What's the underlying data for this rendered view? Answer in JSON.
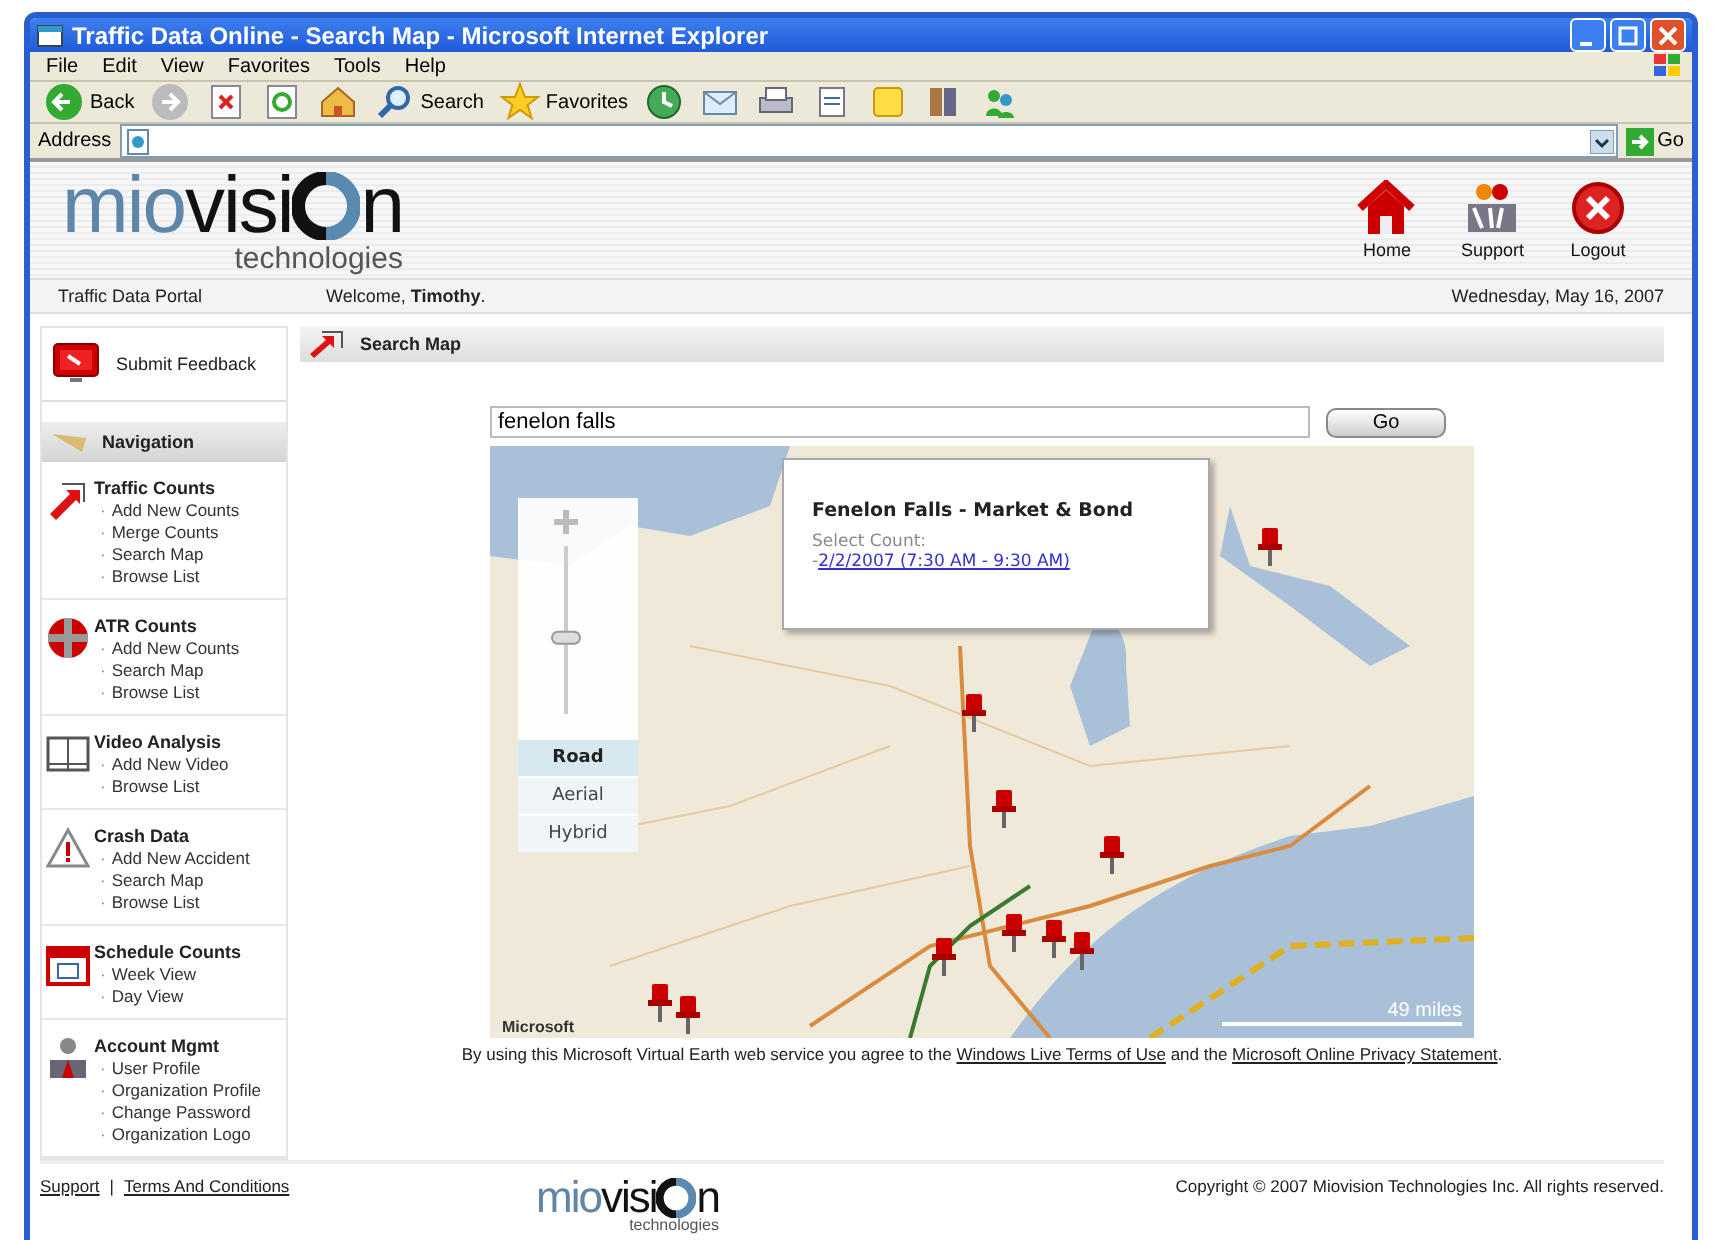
{
  "window": {
    "title": "Traffic Data Online - Search Map - Microsoft Internet Explorer"
  },
  "menu": [
    "File",
    "Edit",
    "View",
    "Favorites",
    "Tools",
    "Help"
  ],
  "toolbar": [
    {
      "kind": "back",
      "label": "Back"
    },
    {
      "kind": "forward"
    },
    {
      "kind": "stop"
    },
    {
      "kind": "refresh"
    },
    {
      "kind": "home"
    },
    {
      "kind": "search",
      "label": "Search"
    },
    {
      "kind": "favorites",
      "label": "Favorites"
    },
    {
      "kind": "history"
    },
    {
      "kind": "mail"
    },
    {
      "kind": "print"
    },
    {
      "kind": "edit"
    },
    {
      "kind": "note"
    },
    {
      "kind": "research"
    },
    {
      "kind": "messenger"
    }
  ],
  "address": {
    "label": "Address",
    "go": "Go"
  },
  "logo": {
    "left": "mio",
    "middle": "visi",
    "right": "n",
    "tagline": "technologies"
  },
  "header_links": [
    {
      "kind": "home",
      "label": "Home"
    },
    {
      "kind": "support",
      "label": "Support"
    },
    {
      "kind": "logout",
      "label": "Logout"
    }
  ],
  "info_bar": {
    "portal": "Traffic Data Portal",
    "welcome": "Welcome, **Timothy**.",
    "date": "Wednesday, May 16, 2007"
  },
  "sidebar": {
    "feedback": "Submit Feedback",
    "nav_title": "Navigation",
    "bullet": "·",
    "sections": [
      {
        "kind": "traffic",
        "title": "Traffic Counts",
        "items": [
          "Add New Counts",
          "Merge Counts",
          "Search Map",
          "Browse List"
        ]
      },
      {
        "kind": "atr",
        "title": "ATR Counts",
        "items": [
          "Add New Counts",
          "Search Map",
          "Browse List"
        ]
      },
      {
        "kind": "video",
        "title": "Video Analysis",
        "items": [
          "Add New Video",
          "Browse List"
        ]
      },
      {
        "kind": "crash",
        "title": "Crash Data",
        "items": [
          "Add New Accident",
          "Search Map",
          "Browse List"
        ]
      },
      {
        "kind": "schedule",
        "title": "Schedule Counts",
        "items": [
          "Week View",
          "Day View"
        ]
      },
      {
        "kind": "account",
        "title": "Account Mgmt",
        "items": [
          "User Profile",
          "Organization Profile",
          "Change Password",
          "Organization Logo"
        ]
      }
    ]
  },
  "main": {
    "title": "Search Map",
    "search": {
      "value": "fenelon falls",
      "button": "Go"
    },
    "map": {
      "popup": {
        "title": "Fenelon Falls - Market & Bond",
        "label": "Select Count:",
        "prefix": "-",
        "link": "2/2/2007 (7:30 AM - 9:30 AM)"
      },
      "map_types": [
        {
          "label": "Road",
          "selected": true
        },
        {
          "label": "Aerial",
          "selected": false
        },
        {
          "label": "Hybrid",
          "selected": false
        }
      ],
      "zoom": {
        "level": 0.45
      },
      "scale": "49 miles",
      "attribution": "Microsoft"
    },
    "terms": {
      "before": "By using this Microsoft Virtual Earth web service you agree to the",
      "link1": "Windows Live Terms of Use",
      "middle": "and the",
      "link2": "Microsoft Online Privacy Statement",
      "after": "."
    }
  },
  "footer": {
    "links": [
      "Support",
      "Terms And Conditions"
    ],
    "separator": "|",
    "copyright": "Copyright © 2007 Miovision Technologies Inc. All rights reserved.",
    "logo": {
      "left": "mio",
      "middle": "visi",
      "right": "n",
      "tagline": "technologies"
    }
  }
}
